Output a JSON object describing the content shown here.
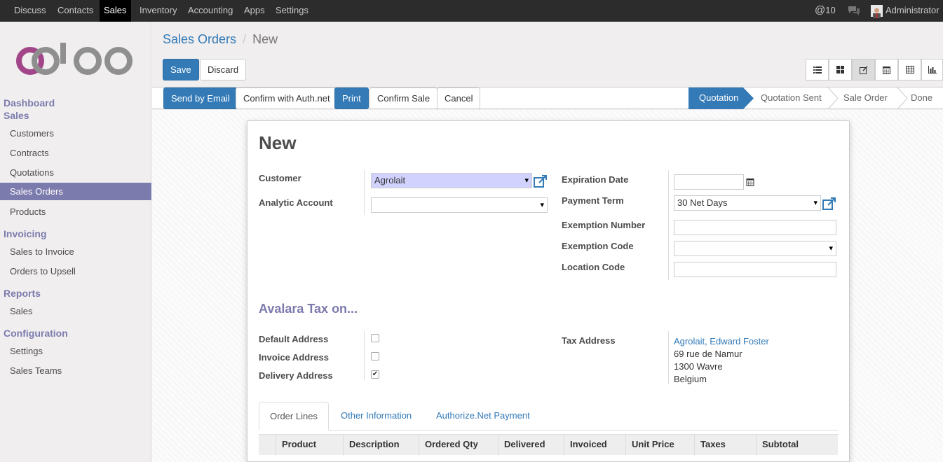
{
  "top_menu": {
    "items": [
      "Discuss",
      "Contacts",
      "Sales",
      "Inventory",
      "Accounting",
      "Apps",
      "Settings"
    ],
    "active": "Sales",
    "messages_count": "10",
    "user": "Administrator"
  },
  "sidebar": {
    "sections": [
      {
        "title": "Dashboard"
      },
      {
        "title": "Sales",
        "items": [
          "Customers",
          "Contracts",
          "Quotations",
          "Sales Orders",
          "Products"
        ]
      },
      {
        "title": "Invoicing",
        "items": [
          "Sales to Invoice",
          "Orders to Upsell"
        ]
      },
      {
        "title": "Reports",
        "items": [
          "Sales"
        ]
      },
      {
        "title": "Configuration",
        "items": [
          "Settings",
          "Sales Teams"
        ]
      }
    ],
    "active_item": "Sales Orders"
  },
  "breadcrumb": {
    "parent": "Sales Orders",
    "sep": "/",
    "current": "New"
  },
  "buttons": {
    "save": "Save",
    "discard": "Discard",
    "send_email": "Send by Email",
    "confirm_auth": "Confirm with Auth.net",
    "print": "Print",
    "confirm_sale": "Confirm Sale",
    "cancel": "Cancel"
  },
  "stages": [
    "Quotation",
    "Quotation Sent",
    "Sale Order",
    "Done"
  ],
  "active_stage": "Quotation",
  "form": {
    "title": "New",
    "customer_label": "Customer",
    "customer_value": "Agrolait",
    "analytic_label": "Analytic Account",
    "analytic_value": "",
    "expiration_label": "Expiration Date",
    "expiration_value": "",
    "payment_term_label": "Payment Term",
    "payment_term_value": "30 Net Days",
    "exemption_number_label": "Exemption Number",
    "exemption_code_label": "Exemption Code",
    "location_code_label": "Location Code",
    "section_title": "Avalara Tax on...",
    "default_address_label": "Default Address",
    "invoice_address_label": "Invoice Address",
    "delivery_address_label": "Delivery Address",
    "default_address_checked": false,
    "invoice_address_checked": false,
    "delivery_address_checked": true,
    "tax_address_label": "Tax Address",
    "tax_address_name": "Agrolait, Edward Foster",
    "tax_address_street": "69 rue de Namur",
    "tax_address_city": "1300 Wavre",
    "tax_address_country": "Belgium"
  },
  "tabs": [
    "Order Lines",
    "Other Information",
    "Authorize.Net Payment"
  ],
  "active_tab": "Order Lines",
  "table_headers": [
    "Product",
    "Description",
    "Ordered Qty",
    "Delivered",
    "Invoiced",
    "Unit Price",
    "Taxes",
    "Subtotal"
  ],
  "colors": {
    "brand_purple": "#7c7bad",
    "primary_blue": "#337ab7",
    "topbar": "#2c2c2c"
  }
}
